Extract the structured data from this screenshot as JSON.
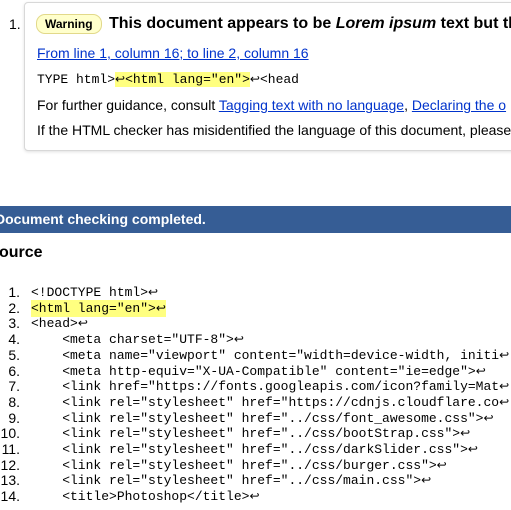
{
  "message": {
    "number": "1.",
    "badge": "Warning",
    "headline_pre": "This document appears to be ",
    "headline_em": "Lorem ipsum",
    "headline_post": " text but the",
    "location": "From line 1, column 16; to line 2, column 16",
    "extract_pre": "TYPE html>",
    "extract_hl": "<html lang=\"en\">",
    "extract_post": "<head",
    "return_glyph": "↩",
    "guidance_pre": "For further guidance, consult ",
    "guidance_link1": "Tagging text with no language",
    "guidance_sep": ", ",
    "guidance_link2": "Declaring the o",
    "misidentified": "If the HTML checker has misidentified the language of this document, please"
  },
  "status_bar": "Document checking completed.",
  "source": {
    "heading": "ource",
    "lines": [
      {
        "num": "1.",
        "text": "<!DOCTYPE html>"
      },
      {
        "num": "2.",
        "text": "<html lang=\"en\">"
      },
      {
        "num": "3.",
        "text": "<head>"
      },
      {
        "num": "4.",
        "text": "    <meta charset=\"UTF-8\">"
      },
      {
        "num": "5.",
        "text": "    <meta name=\"viewport\" content=\"width=device-width, initi"
      },
      {
        "num": "6.",
        "text": "    <meta http-equiv=\"X-UA-Compatible\" content=\"ie=edge\">"
      },
      {
        "num": "7.",
        "text": "    <link href=\"https://fonts.googleapis.com/icon?family=Mat"
      },
      {
        "num": "8.",
        "text": "    <link rel=\"stylesheet\" href=\"https://cdnjs.cloudflare.co"
      },
      {
        "num": "9.",
        "text": "    <link rel=\"stylesheet\" href=\"../css/font_awesome.css\">"
      },
      {
        "num": "10.",
        "text": "    <link rel=\"stylesheet\" href=\"../css/bootStrap.css\">"
      },
      {
        "num": "11.",
        "text": "    <link rel=\"stylesheet\" href=\"../css/darkSlider.css\">"
      },
      {
        "num": "12.",
        "text": "    <link rel=\"stylesheet\" href=\"../css/burger.css\">"
      },
      {
        "num": "13.",
        "text": "    <link rel=\"stylesheet\" href=\"../css/main.css\">"
      },
      {
        "num": "14.",
        "text": "    <title>Photoshop</title>"
      }
    ]
  },
  "colors": {
    "bar_bg": "#365d95",
    "highlight": "#ffff80",
    "link": "#0033cc",
    "badge_bg": "#ffffcc"
  }
}
